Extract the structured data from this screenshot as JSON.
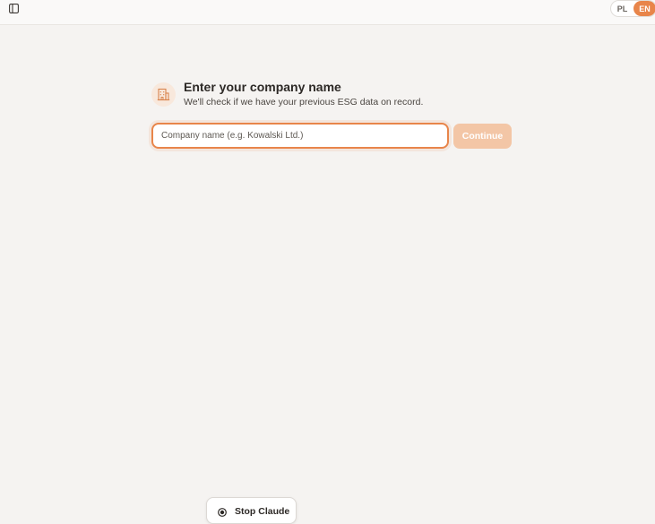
{
  "topbar": {
    "sidebar_toggle_icon": "sidebar-panel-icon",
    "languages": [
      {
        "code": "PL",
        "active": false
      },
      {
        "code": "EN",
        "active": true
      }
    ]
  },
  "colors": {
    "accent": "#e8854a",
    "accent_light": "#f3c6a6",
    "background": "#f5f3f1"
  },
  "prompt": {
    "icon": "building-icon",
    "title": "Enter your company name",
    "subtitle": "We'll check if we have your previous ESG data on record."
  },
  "form": {
    "company_value": "",
    "company_placeholder": "Company name (e.g. Kowalski Ltd.)",
    "continue_label": "Continue"
  },
  "overlay": {
    "stop_label": "Stop Claude",
    "stop_icon": "stop-circle-icon"
  }
}
